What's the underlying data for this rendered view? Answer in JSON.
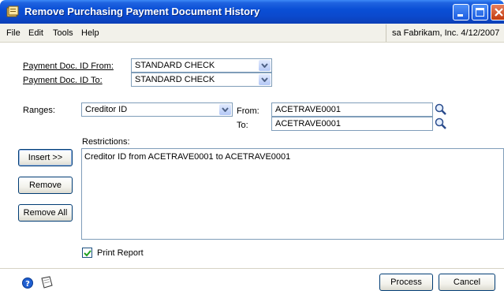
{
  "window": {
    "title": "Remove Purchasing Payment Document History"
  },
  "menu": {
    "file": "File",
    "edit": "Edit",
    "tools": "Tools",
    "help": "Help"
  },
  "user_info": "sa  Fabrikam, Inc.  4/12/2007",
  "payment_from": {
    "label": "Payment Doc. ID From:",
    "value": "STANDARD CHECK"
  },
  "payment_to": {
    "label": "Payment Doc. ID To:",
    "value": "STANDARD CHECK"
  },
  "ranges": {
    "label": "Ranges:",
    "value": "Creditor ID",
    "from_label": "From:",
    "from_value": "ACETRAVE0001",
    "to_label": "To:",
    "to_value": "ACETRAVE0001"
  },
  "restrictions": {
    "label": "Restrictions:",
    "items": [
      "Creditor ID from ACETRAVE0001 to ACETRAVE0001"
    ]
  },
  "buttons": {
    "insert": "Insert >>",
    "remove": "Remove",
    "remove_all": "Remove All",
    "process": "Process",
    "cancel": "Cancel"
  },
  "print_report": {
    "label": "Print Report",
    "checked": true
  },
  "colors": {
    "title_bar": "#0a4fd6",
    "control_border": "#7f9db9",
    "button_border": "#003c74"
  }
}
